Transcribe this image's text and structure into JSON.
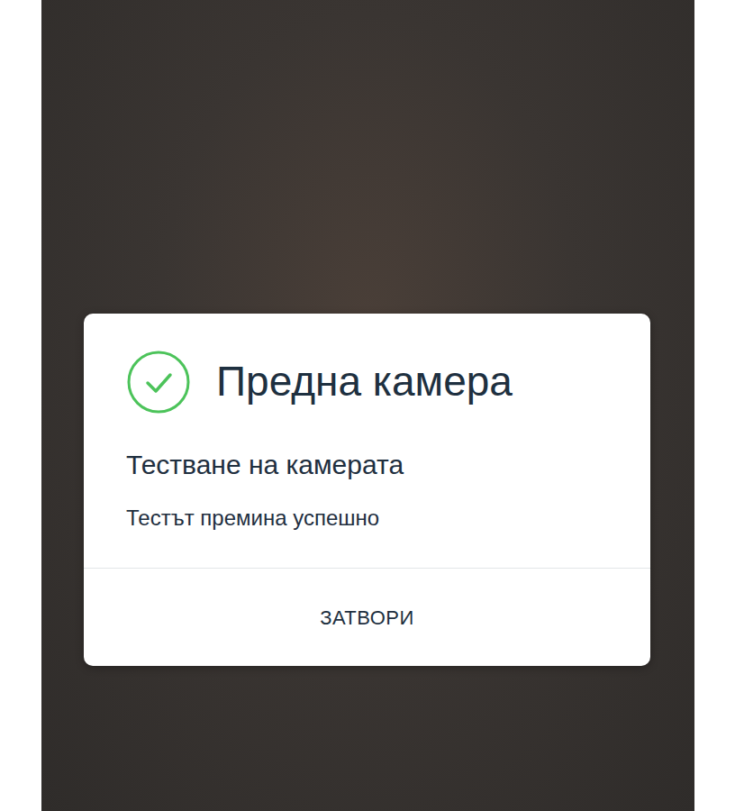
{
  "dialog": {
    "title": "Предна камера",
    "passed": true,
    "heading": "Тестване на камерата",
    "message": "Тестът премина успешно",
    "buttons": [
      "ЗАТВОРИ"
    ]
  }
}
